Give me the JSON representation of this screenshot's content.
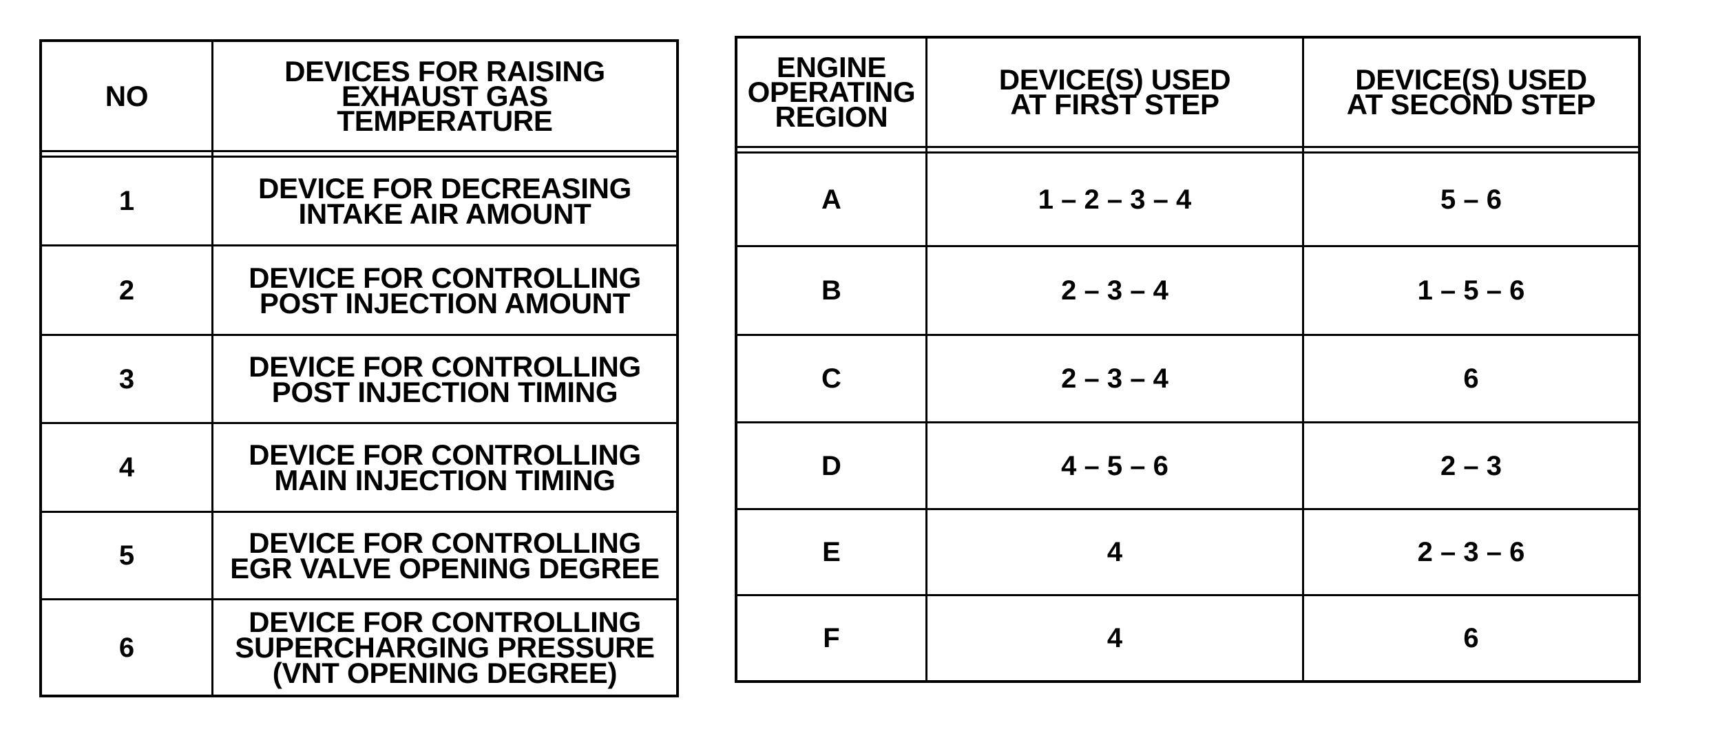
{
  "devices_table": {
    "headers": {
      "no": "NO",
      "device": [
        "DEVICES FOR RAISING",
        "EXHAUST GAS",
        "TEMPERATURE"
      ]
    },
    "rows": [
      {
        "no": "1",
        "lines": [
          "DEVICE FOR DECREASING",
          "INTAKE AIR AMOUNT"
        ]
      },
      {
        "no": "2",
        "lines": [
          "DEVICE FOR CONTROLLING",
          "POST INJECTION AMOUNT"
        ]
      },
      {
        "no": "3",
        "lines": [
          "DEVICE FOR CONTROLLING",
          "POST INJECTION TIMING"
        ]
      },
      {
        "no": "4",
        "lines": [
          "DEVICE FOR CONTROLLING",
          "MAIN INJECTION TIMING"
        ]
      },
      {
        "no": "5",
        "lines": [
          "DEVICE FOR CONTROLLING",
          "EGR VALVE OPENING DEGREE"
        ]
      },
      {
        "no": "6",
        "lines": [
          "DEVICE FOR CONTROLLING",
          "SUPERCHARGING PRESSURE",
          "(VNT OPENING DEGREE)"
        ]
      }
    ]
  },
  "regions_table": {
    "headers": {
      "region": [
        "ENGINE",
        "OPERATING",
        "REGION"
      ],
      "first_step": [
        "DEVICE(S) USED",
        "AT FIRST STEP"
      ],
      "second_step": [
        "DEVICE(S) USED",
        "AT SECOND STEP"
      ]
    },
    "rows": [
      {
        "region": "A",
        "first_step": "1 – 2 – 3 – 4",
        "second_step": "5 – 6"
      },
      {
        "region": "B",
        "first_step": "2 – 3 – 4",
        "second_step": "1 – 5 – 6"
      },
      {
        "region": "C",
        "first_step": "2 – 3 – 4",
        "second_step": "6"
      },
      {
        "region": "D",
        "first_step": "4 – 5 – 6",
        "second_step": "2 – 3"
      },
      {
        "region": "E",
        "first_step": "4",
        "second_step": "2 – 3 – 6"
      },
      {
        "region": "F",
        "first_step": "4",
        "second_step": "6"
      }
    ]
  }
}
